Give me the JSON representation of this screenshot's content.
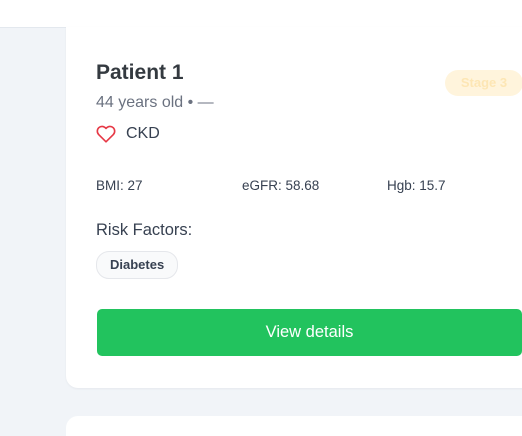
{
  "patient": {
    "name": "Patient 1",
    "subline": "44 years old • —",
    "stage_badge": "Stage 3",
    "condition": "CKD",
    "metrics": {
      "bmi": "BMI: 27",
      "egfr": "eGFR: 58.68",
      "hgb": "Hgb: 15.7"
    },
    "risk_factors_title": "Risk Factors:",
    "risk_factors": [
      "Diabetes"
    ],
    "view_details_label": "View details"
  },
  "icons": {
    "condition_icon": "heart-icon",
    "logo_icon": "logo-icon"
  },
  "colors": {
    "accent_green": "#22c35e",
    "heart_red": "#e63946",
    "stage_badge_bg": "#fff4dc",
    "logo_blue": "#3b82f6",
    "logo_teal": "#38bdf8"
  }
}
